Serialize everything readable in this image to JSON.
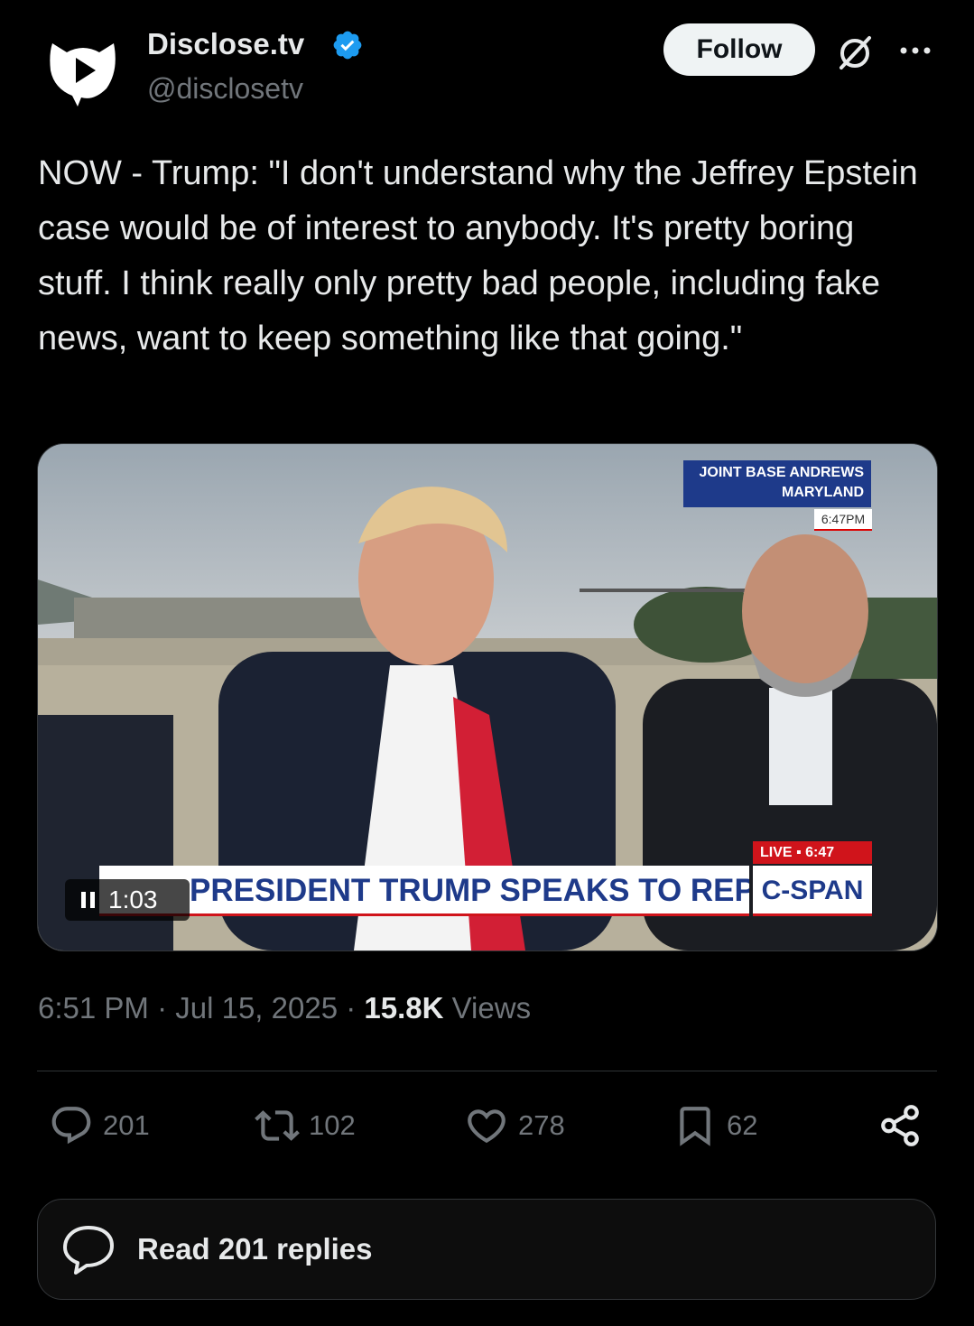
{
  "author": {
    "name": "Disclose.tv",
    "handle": "@disclosetv",
    "verified": true,
    "avatar_icon": "play-bubble-icon"
  },
  "header": {
    "follow_label": "Follow",
    "grok_icon": "grok-icon",
    "more_icon": "more-icon"
  },
  "tweet": {
    "text": "NOW - Trump: \"I don't understand why the Jeffrey Epstein case would be of interest to anybody. It's pretty boring stuff. I think really only pretty bad people, including fake news, want to keep something like that going.\""
  },
  "video": {
    "location_line1": "JOINT BASE ANDREWS",
    "location_line2": "MARYLAND",
    "location_time": "6:47PM",
    "lower_third": "PRESIDENT TRUMP SPEAKS TO REPORTERS",
    "live_badge": "LIVE ▪ 6:47",
    "network": "C-SPAN",
    "time_remaining": "1:03"
  },
  "meta": {
    "time": "6:51 PM",
    "date": "Jul 15, 2025",
    "views_count": "15.8K",
    "views_label": "Views"
  },
  "actions": {
    "replies": "201",
    "reposts": "102",
    "likes": "278",
    "bookmarks": "62"
  },
  "read_replies_label": "Read 201 replies",
  "colors": {
    "background": "#000000",
    "text": "#e7e9ea",
    "muted": "#71767b",
    "verified": "#1d9bf0"
  }
}
